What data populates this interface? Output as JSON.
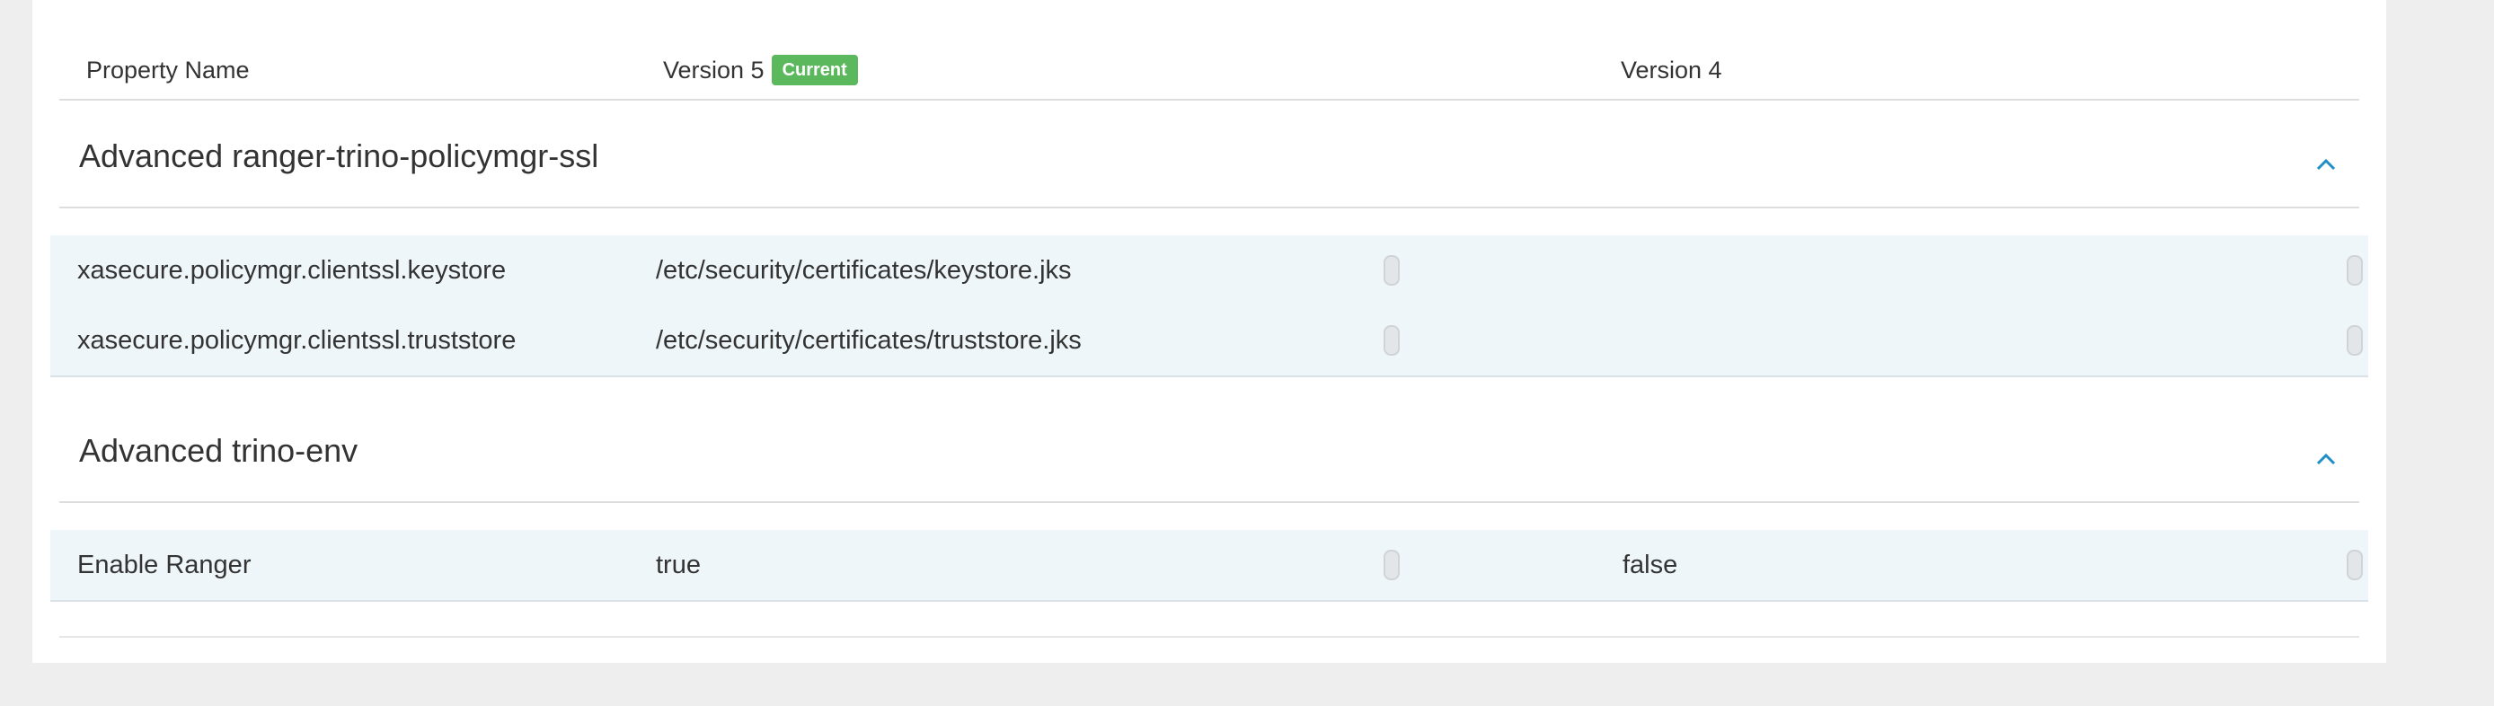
{
  "header": {
    "property_name": "Property Name",
    "version_current": "Version 5",
    "current_badge": "Current",
    "version_previous": "Version 4"
  },
  "sections": [
    {
      "title": "Advanced ranger-trino-policymgr-ssl",
      "rows": [
        {
          "name": "xasecure.policymgr.clientssl.keystore",
          "v5": "/etc/security/certificates/keystore.jks",
          "v4": ""
        },
        {
          "name": "xasecure.policymgr.clientssl.truststore",
          "v5": "/etc/security/certificates/truststore.jks",
          "v4": ""
        }
      ]
    },
    {
      "title": "Advanced trino-env",
      "rows": [
        {
          "name": "Enable Ranger",
          "v5": "true",
          "v4": "false"
        }
      ]
    }
  ],
  "colors": {
    "badge": "#5cb85c",
    "row_bg": "#eef6f9",
    "chevron": "#1e8fc6"
  },
  "icons": {
    "collapse": "chevron-up-icon",
    "resize_handle": "drag-handle-icon"
  }
}
